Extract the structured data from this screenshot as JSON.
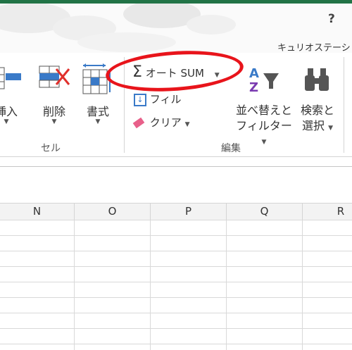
{
  "titlebar": {
    "help": "?",
    "account": "キュリオステーシ"
  },
  "cells_group": {
    "insert_label": "挿入",
    "delete_label": "削除",
    "format_label": "書式",
    "group_label": "セル"
  },
  "editing_group": {
    "autosum_label": "オート SUM",
    "fill_label": "フィル",
    "clear_label": "クリア",
    "sort_line1": "並べ替えと",
    "sort_line2": "フィルター",
    "find_line1": "検索と",
    "find_line2": "選択",
    "group_label": "編集"
  },
  "columns": [
    "N",
    "O",
    "P",
    "Q",
    "R"
  ],
  "colors": {
    "accent": "#217346",
    "highlight": "#e8141b"
  }
}
